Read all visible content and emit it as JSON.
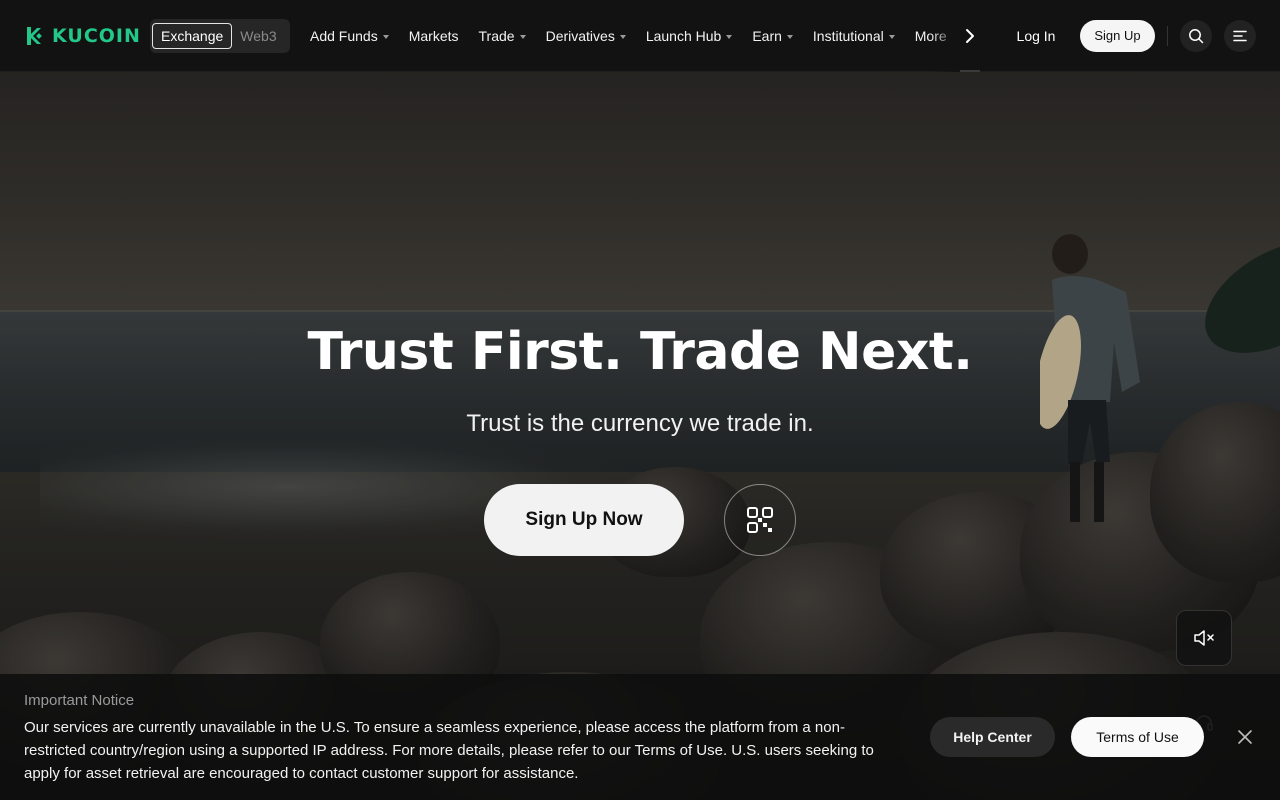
{
  "brand": {
    "name": "KUCOIN",
    "accent": "#23c78a"
  },
  "mode_toggle": {
    "active": "Exchange",
    "inactive": "Web3"
  },
  "menu": {
    "items": [
      {
        "label": "Add Funds",
        "dropdown": true
      },
      {
        "label": "Markets",
        "dropdown": false
      },
      {
        "label": "Trade",
        "dropdown": true
      },
      {
        "label": "Derivatives",
        "dropdown": true
      },
      {
        "label": "Launch Hub",
        "dropdown": true
      },
      {
        "label": "Earn",
        "dropdown": true
      },
      {
        "label": "Institutional",
        "dropdown": true
      },
      {
        "label": "More",
        "dropdown": false
      }
    ],
    "next_icon": "chevron-right-icon"
  },
  "auth": {
    "login": "Log In",
    "signup": "Sign Up"
  },
  "icons": {
    "search": "search-icon",
    "menu": "menu-icon",
    "qr": "qr-code-icon",
    "mute": "speaker-muted-icon",
    "support": "headset-icon",
    "close": "close-icon"
  },
  "hero": {
    "title": "Trust First. Trade Next.",
    "subtitle": "Trust is the currency we trade in.",
    "cta": "Sign Up Now"
  },
  "notice": {
    "title": "Important Notice",
    "body": "Our services are currently unavailable in the U.S. To ensure a seamless experience, please access the platform from a non-restricted country/region using a supported IP address. For more details, please refer to our Terms of Use. U.S. users seeking to apply for asset retrieval are encouraged to contact customer support for assistance.",
    "help_button": "Help Center",
    "terms_button": "Terms of Use"
  }
}
